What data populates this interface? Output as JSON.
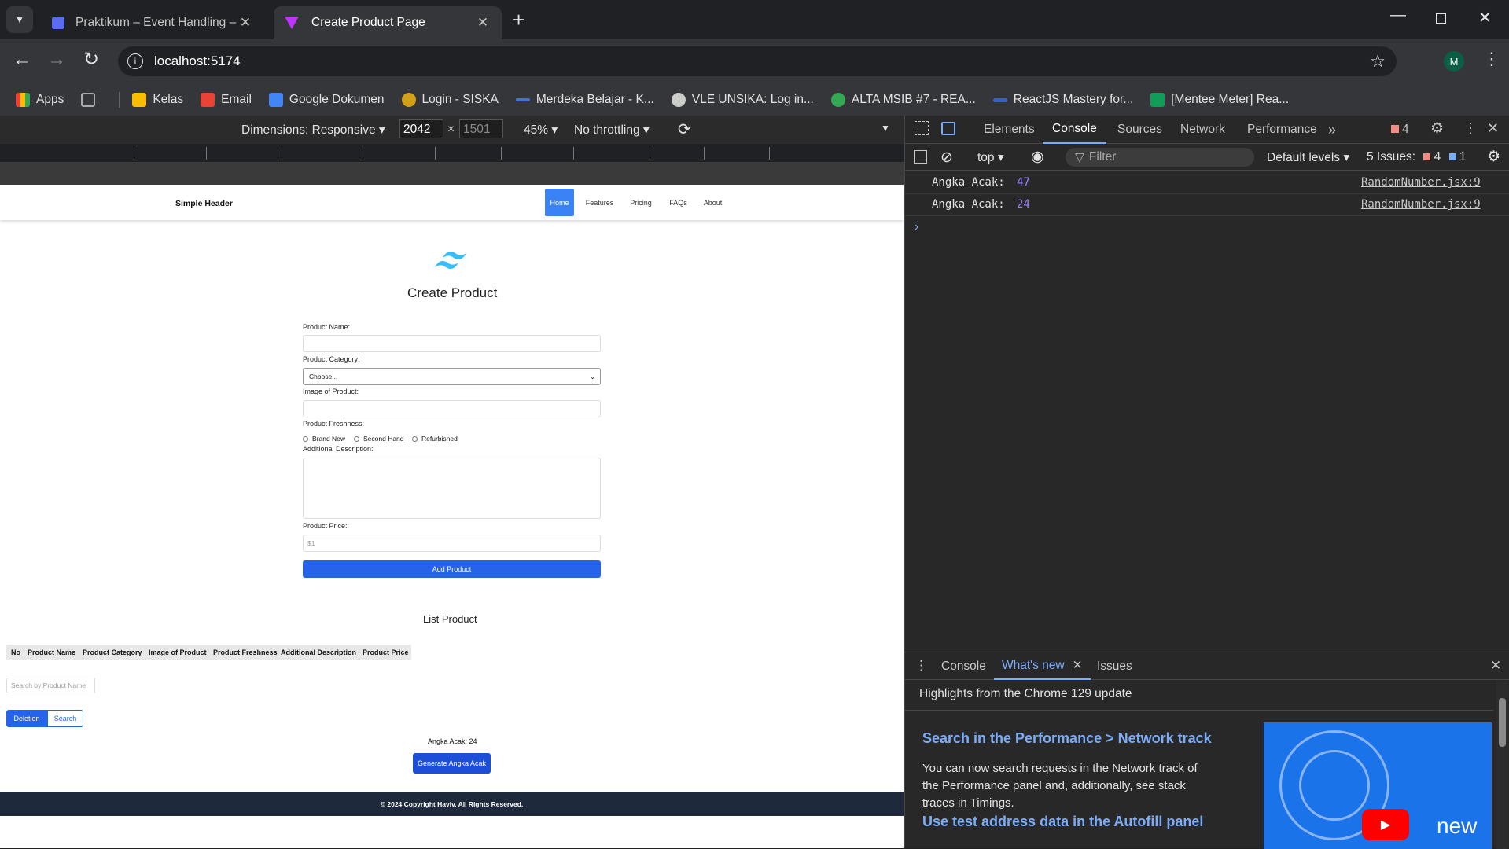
{
  "browser": {
    "tabs": [
      {
        "title": "Praktikum – Event Handling – C"
      },
      {
        "title": "Create Product Page"
      }
    ],
    "url": "localhost:5174",
    "profile_initial": "M",
    "bookmarks": [
      {
        "label": "Apps",
        "color": "#ea4335"
      },
      {
        "label": "",
        "color": "#aaaaaa"
      },
      {
        "label": "Kelas",
        "color": "#fbbc04"
      },
      {
        "label": "Email",
        "color": "#ea4335"
      },
      {
        "label": "Google Dokumen",
        "color": "#4285f4"
      },
      {
        "label": "Login - SISKA",
        "color": "#d4a017"
      },
      {
        "label": "Merdeka Belajar - K...",
        "color": "#4a6fdc"
      },
      {
        "label": "VLE UNSIKA: Log in...",
        "color": "#cccccc"
      },
      {
        "label": "ALTA MSIB #7 - REA...",
        "color": "#34a853"
      },
      {
        "label": "ReactJS Mastery for...",
        "color": "#3b5bdb"
      },
      {
        "label": "[Mentee Meter] Rea...",
        "color": "#0f9d58"
      }
    ]
  },
  "device_toolbar": {
    "dimensions": "Dimensions: Responsive",
    "width": "2042",
    "height": "1501",
    "zoom": "45%",
    "throttling": "No throttling"
  },
  "page": {
    "header_title": "Simple Header",
    "nav": [
      "Home",
      "Features",
      "Pricing",
      "FAQs",
      "About"
    ],
    "form_title": "Create Product",
    "labels": {
      "name": "Product Name:",
      "category": "Product Category:",
      "image": "Image of Product:",
      "freshness": "Product Freshness:",
      "description": "Additional Description:",
      "price": "Product Price:"
    },
    "category_selected": "Choose...",
    "freshness_options": [
      "Brand New",
      "Second Hand",
      "Refurbished"
    ],
    "price_placeholder": "$1",
    "add_button": "Add Product",
    "list_title": "List Product",
    "table_headers": [
      "No",
      "Product Name",
      "Product Category",
      "Image of Product",
      "Product Freshness",
      "Additional Description",
      "Product Price"
    ],
    "search_placeholder": "Search by Product Name",
    "deletion_button": "Deletion",
    "search_button": "Search",
    "random_text": "Angka Acak: 24",
    "generate_button": "Generate Angka Acak",
    "footer": "© 2024 Copyright Haviv. All Rights Reserved."
  },
  "devtools": {
    "tabs": [
      "Elements",
      "Console",
      "Sources",
      "Network",
      "Performance"
    ],
    "active_tab": "Console",
    "error_count": "4",
    "context": "top",
    "filter_placeholder": "Filter",
    "levels": "Default levels",
    "issues_label": "5 Issues:",
    "issues_errors": "4",
    "issues_info": "1",
    "logs": [
      {
        "label": "Angka Acak:",
        "value": "47",
        "source": "RandomNumber.jsx:9"
      },
      {
        "label": "Angka Acak:",
        "value": "24",
        "source": "RandomNumber.jsx:9"
      }
    ],
    "drawer_tabs": [
      "Console",
      "What's new",
      "Issues"
    ],
    "drawer_active": "What's new",
    "highlights": "Highlights from the Chrome 129 update",
    "news1_title": "Search in the Performance > Network track",
    "news1_body": "You can now search requests in the Network track of the Performance panel and, additionally, see stack traces in Timings.",
    "news2_title": "Use test address data in the Autofill panel",
    "thumb_text": "new"
  }
}
